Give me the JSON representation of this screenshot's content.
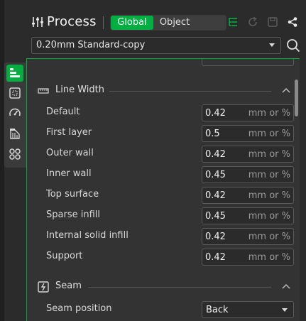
{
  "header": {
    "title": "Process",
    "toggle": {
      "global": "Global",
      "object": "Object",
      "selected": "Global"
    },
    "icons": [
      "process-settings-icon",
      "list-tree-icon",
      "refresh-icon",
      "save-icon",
      "compare-icon"
    ]
  },
  "preset": {
    "value": "0.20mm Standard-copy"
  },
  "side_tabs": [
    "quality-icon",
    "strength-icon",
    "speed-icon",
    "support-icon",
    "others-icon"
  ],
  "sections": {
    "line_width": {
      "title": "Line Width",
      "unit": "mm or %",
      "rows": [
        {
          "label": "Default",
          "value": "0.42"
        },
        {
          "label": "First layer",
          "value": "0.5"
        },
        {
          "label": "Outer wall",
          "value": "0.42"
        },
        {
          "label": "Inner wall",
          "value": "0.45"
        },
        {
          "label": "Top surface",
          "value": "0.42"
        },
        {
          "label": "Sparse infill",
          "value": "0.45"
        },
        {
          "label": "Internal solid infill",
          "value": "0.42"
        },
        {
          "label": "Support",
          "value": "0.42"
        }
      ]
    },
    "seam": {
      "title": "Seam",
      "rows": [
        {
          "label": "Seam position",
          "value": "Back"
        }
      ]
    }
  },
  "colors": {
    "accent": "#00ae42",
    "background": "#2b2b2b",
    "panel": "#333333"
  }
}
